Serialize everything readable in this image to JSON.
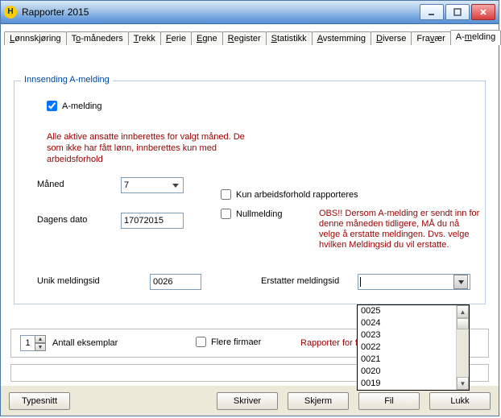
{
  "window": {
    "title": "Rapporter 2015",
    "icon_letter": "H"
  },
  "tabs": [
    {
      "label": "Lønnskjøring",
      "hotkey": 0
    },
    {
      "label": "To-måneders",
      "hotkey": 1
    },
    {
      "label": "Trekk",
      "hotkey": 0
    },
    {
      "label": "Ferie",
      "hotkey": 0
    },
    {
      "label": "Egne",
      "hotkey": 0
    },
    {
      "label": "Register",
      "hotkey": 0
    },
    {
      "label": "Statistikk",
      "hotkey": 0
    },
    {
      "label": "Avstemming",
      "hotkey": 0
    },
    {
      "label": "Diverse",
      "hotkey": 0
    },
    {
      "label": "Fravær",
      "hotkey": 3
    },
    {
      "label": "A-melding",
      "hotkey": 2
    }
  ],
  "active_tab": 10,
  "group": {
    "title": "Innsending A-melding",
    "amelding_checkbox_label": "A-melding",
    "amelding_checked": true,
    "info": "Alle aktive ansatte innberettes for valgt måned. De som ikke har fått lønn, innberettes kun med arbeidsforhold",
    "maaned_label": "Måned",
    "maaned_value": "7",
    "dato_label": "Dagens dato",
    "dato_value": "17072015",
    "kun_arb_label": "Kun arbeidsforhold rapporteres",
    "kun_arb_checked": false,
    "null_label": "Nullmelding",
    "null_checked": false,
    "obs": "OBS!! Dersom A-melding er sendt inn for denne måneden tidligere, MÅ du nå velge å erstatte meldingen. Dvs. velge hvilken Meldingsid du vil erstatte.",
    "unik_label": "Unik meldingsid",
    "unik_value": "0026",
    "erst_label": "Erstatter meldingsid",
    "erst_value": "",
    "erst_options": [
      "0025",
      "0024",
      "0023",
      "0022",
      "0021",
      "0020",
      "0019"
    ]
  },
  "print": {
    "copies_value": "1",
    "copies_label": "Antall eksemplar",
    "flere_label": "Flere firmaer",
    "flere_checked": false,
    "rapporter_for": "Rapporter for f"
  },
  "footer": {
    "typesnitt": "Typesnitt",
    "skriver": "Skriver",
    "skjerm": "Skjerm",
    "fil": "Fil",
    "lukk": "Lukk"
  }
}
